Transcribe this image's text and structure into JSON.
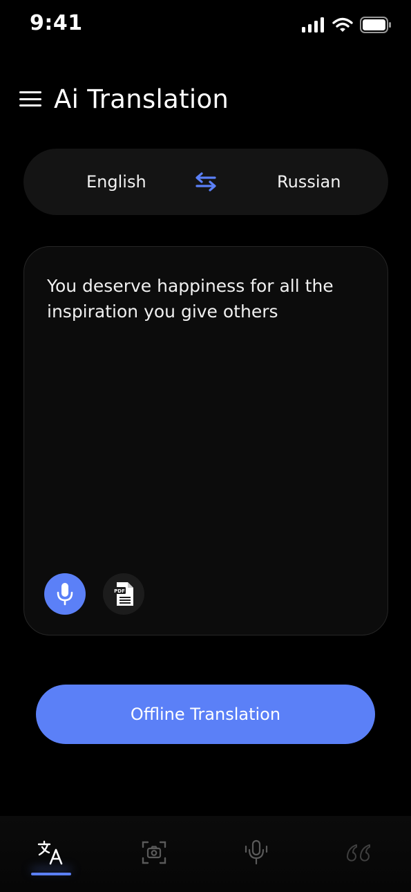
{
  "status_bar": {
    "time": "9:41",
    "icons": [
      "signal-icon",
      "wifi-icon",
      "battery-icon"
    ]
  },
  "header": {
    "menu_icon": "menu-icon",
    "title": "Ai Translation"
  },
  "language_bar": {
    "source": "English",
    "target": "Russian",
    "swap_icon": "swap-arrows-icon"
  },
  "text_card": {
    "input_text": "You deserve happiness for all the inspiration you give others",
    "mic_icon": "microphone-icon",
    "pdf_icon": "pdf-file-icon"
  },
  "primary_button": {
    "label": "Offline Translation"
  },
  "tab_bar": {
    "tabs": [
      {
        "icon": "translate-icon",
        "active": true
      },
      {
        "icon": "camera-icon",
        "active": false
      },
      {
        "icon": "voice-icon",
        "active": false
      },
      {
        "icon": "quotes-icon",
        "active": false
      }
    ]
  },
  "colors": {
    "background": "#000000",
    "accent": "#5b80f7",
    "surface": "#141414",
    "card": "#0c0c0c",
    "inactive_icon": "#5a5a5a"
  }
}
